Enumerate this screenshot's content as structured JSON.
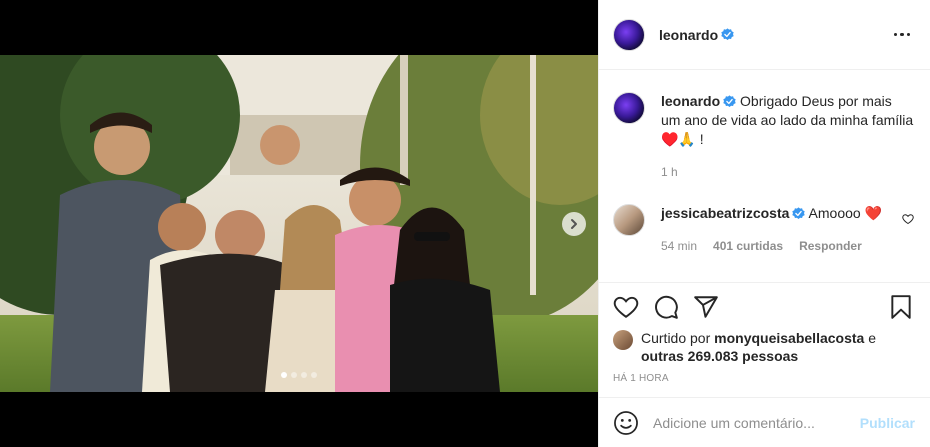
{
  "post": {
    "username": "leonardo",
    "verified": true,
    "carousel": {
      "slide_count": 4,
      "active_slide": 1
    }
  },
  "caption": {
    "username": "leonardo",
    "text": "Obrigado Deus por mais um ano de vida ao lado da minha família ♥️🙏 !",
    "time": "1 h"
  },
  "comments": [
    {
      "username": "jessicabeatrizcosta",
      "verified": true,
      "text": "Amoooo ❤️",
      "time": "54 min",
      "likes": "401 curtidas",
      "reply_label": "Responder"
    }
  ],
  "likes": {
    "prefix": "Curtido por",
    "user": "monyqueisabellacosta",
    "connector": "e",
    "others": "outras 269.083 pessoas"
  },
  "timestamp": "HÁ 1 HORA",
  "add_comment": {
    "placeholder": "Adicione um comentário...",
    "publish_label": "Publicar"
  },
  "icons": {
    "like": "heart-icon",
    "comment": "comment-icon",
    "share": "share-icon",
    "save": "bookmark-icon",
    "emoji": "emoji-icon",
    "more": "more-options-icon",
    "verified": "verified-badge-icon",
    "next": "chevron-right-icon"
  },
  "colors": {
    "verified_blue": "#3897f0",
    "text": "#262626",
    "muted": "#8e8e8e",
    "publish_disabled": "#b2dffc",
    "heart_red": "#ed4956"
  }
}
